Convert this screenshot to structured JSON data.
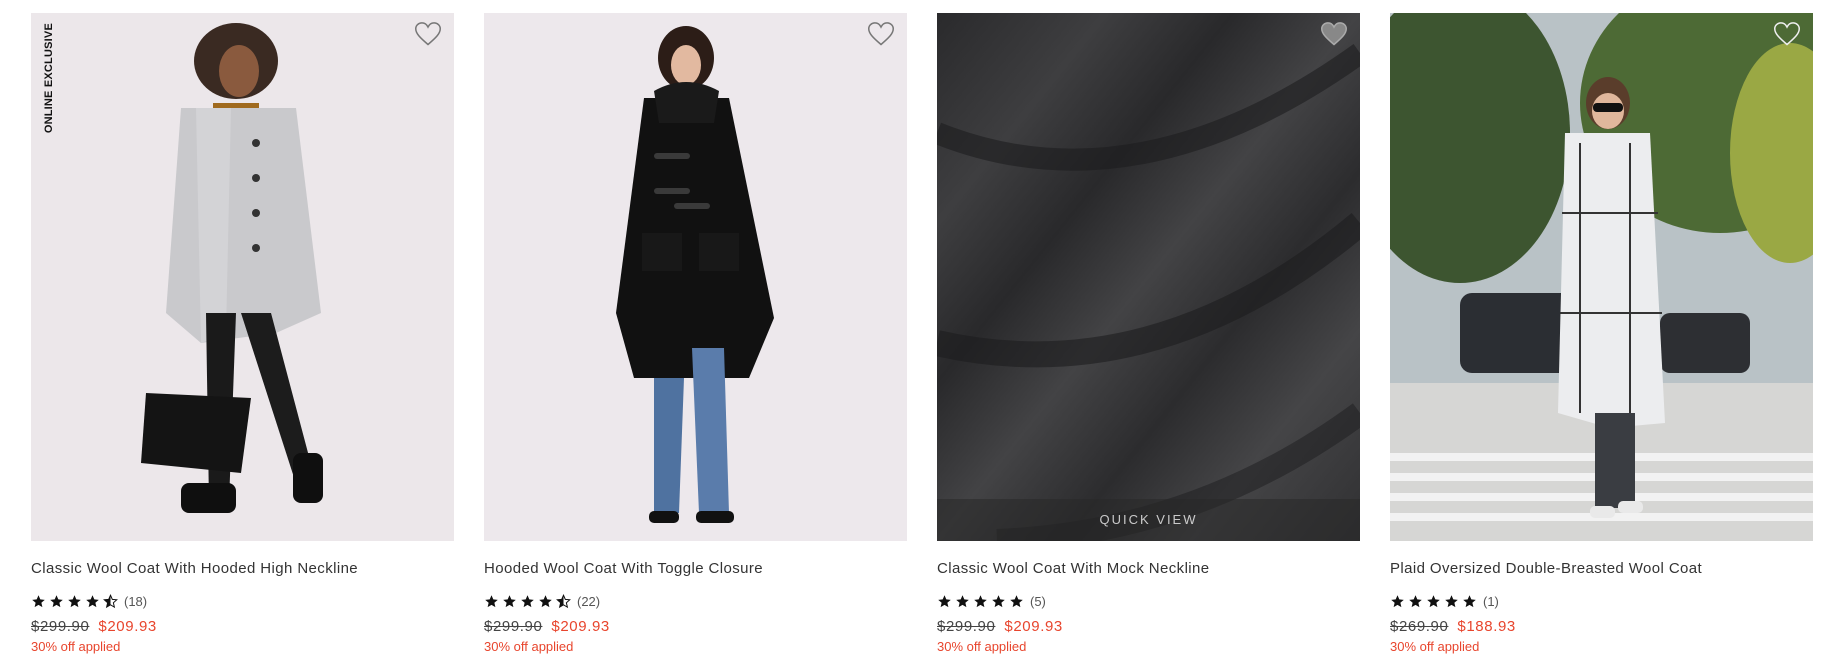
{
  "products": [
    {
      "title": "Classic Wool Coat With Hooded High Neckline",
      "badge": "ONLINE EXCLUSIVE",
      "rating": 4.5,
      "review_count": "(18)",
      "original_price": "$299.90",
      "sale_price": "$209.93",
      "promo": "30% off applied"
    },
    {
      "title": "Hooded Wool Coat With Toggle Closure",
      "rating": 4.5,
      "review_count": "(22)",
      "original_price": "$299.90",
      "sale_price": "$209.93",
      "promo": "30% off applied"
    },
    {
      "title": "Classic Wool Coat With Mock Neckline",
      "quick_view": "QUICK VIEW",
      "rating": 5,
      "review_count": "(5)",
      "original_price": "$299.90",
      "sale_price": "$209.93",
      "promo": "30% off applied"
    },
    {
      "title": "Plaid Oversized Double-Breasted Wool Coat",
      "rating": 5,
      "review_count": "(1)",
      "original_price": "$269.90",
      "sale_price": "$188.93",
      "promo": "30% off applied"
    }
  ],
  "icons": {
    "wishlist": "heart-outline-icon",
    "star": "star-icon"
  },
  "colors": {
    "sale": "#e8452d",
    "text": "#333333",
    "star": "#111111"
  }
}
